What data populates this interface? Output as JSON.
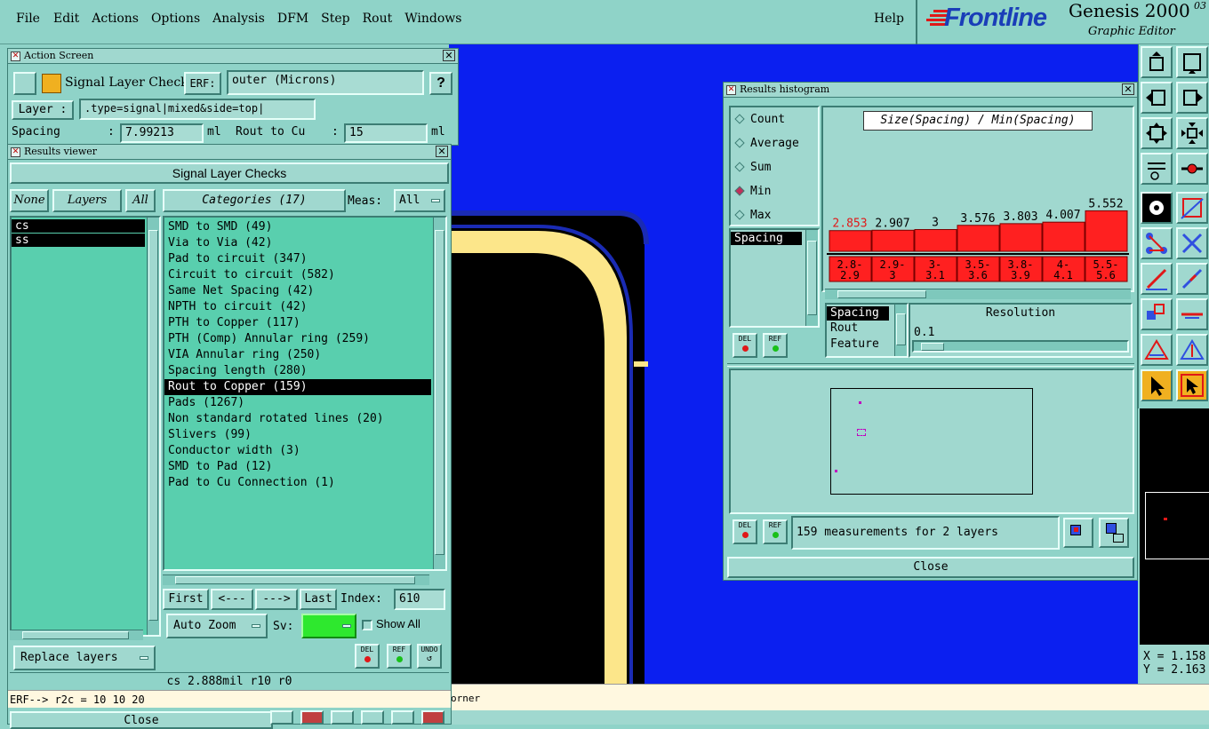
{
  "menubar": {
    "items": [
      "File",
      "Edit",
      "Actions",
      "Options",
      "Analysis",
      "DFM",
      "Step",
      "Rout",
      "Windows"
    ],
    "help": "Help",
    "brand": "Frontline",
    "product": "Genesis 2000",
    "version": "03",
    "subtitle": "Graphic Editor"
  },
  "action_screen": {
    "title": "Action Screen",
    "check_name": "Signal Layer Checks",
    "erf_label": "ERF:",
    "erf_value": "outer (Microns)",
    "help_label": "?",
    "layer_label": "Layer :",
    "layer_value": ".type=signal|mixed&side=top|",
    "spacing_label": "Spacing",
    "spacing_sep": ":",
    "spacing_value": "7.99213",
    "spacing_unit": "ml",
    "rout_label": "Rout to Cu",
    "rout_sep": ":",
    "rout_value": "15",
    "rout_unit": "ml"
  },
  "results_viewer": {
    "title": "Results viewer",
    "heading": "Signal Layer Checks",
    "none_label": "None",
    "layers_label": "Layers",
    "all_label": "All",
    "layers": [
      "cs",
      "ss"
    ],
    "categories_label": "Categories (17)",
    "meas_label": "Meas:",
    "meas_value": "All",
    "categories": [
      "SMD to SMD (49)",
      "Via to Via (42)",
      "Pad to circuit (347)",
      "Circuit to circuit (582)",
      "Same Net Spacing (42)",
      "NPTH to circuit (42)",
      "PTH to Copper (117)",
      "PTH (Comp) Annular ring (259)",
      "VIA Annular ring (250)",
      "Spacing length (280)",
      "Rout to Copper (159)",
      "Pads (1267)",
      "Non standard rotated lines (20)",
      "Slivers (99)",
      "Conductor width (3)",
      "SMD to Pad (12)",
      "Pad to Cu Connection (1)"
    ],
    "selected_category": 10,
    "first_label": "First",
    "prev_label": "<---",
    "next_label": "--->",
    "last_label": "Last",
    "index_label": "Index:",
    "index_value": "610",
    "autozoom_label": "Auto Zoom",
    "sv_label": "Sv:",
    "showall_label": "Show All",
    "replace_label": "Replace layers",
    "del_label": "DEL",
    "ref_label": "REF",
    "undo_label": "UNDO",
    "status": "cs 2.888mil  r10  r0",
    "erf_line": "ERF--> r2c = 10 10 20",
    "close_label": "Close"
  },
  "histogram": {
    "title": "Results histogram",
    "options": [
      "Count",
      "Average",
      "Sum",
      "Min",
      "Max"
    ],
    "selected_option": 3,
    "chart_title": "Size(Spacing) / Min(Spacing)",
    "field_list": [
      "Spacing"
    ],
    "axis_options": [
      "Spacing",
      "Rout",
      "Feature"
    ],
    "resolution_label": "Resolution",
    "resolution_value": "0.1",
    "del_label": "DEL",
    "ref_label": "REF",
    "measurement_text": "159 measurements for 2 layers",
    "close_label": "Close"
  },
  "chart_data": {
    "type": "bar",
    "title": "Size(Spacing) / Min(Spacing)",
    "categories": [
      "2.8-2.9",
      "2.9-3",
      "3-3.1",
      "3.5-3.6",
      "3.8-3.9",
      "4-4.1",
      "5.5-5.6"
    ],
    "category_lines": [
      [
        "2.8-",
        "2.9"
      ],
      [
        "2.9-",
        "3"
      ],
      [
        "3-",
        "3.1"
      ],
      [
        "3.5-",
        "3.6"
      ],
      [
        "3.8-",
        "3.9"
      ],
      [
        "4-",
        "4.1"
      ],
      [
        "5.5-",
        "5.6"
      ]
    ],
    "value_labels": [
      "2.853",
      "2.907",
      "3",
      "3.576",
      "3.803",
      "4.007",
      "5.552"
    ],
    "values": [
      2.853,
      2.907,
      3,
      3.576,
      3.803,
      4.007,
      5.552
    ],
    "ylim": [
      2.7,
      5.6
    ]
  },
  "coords": {
    "x_label": "X = 1.158",
    "y_label": "Y = 2.163"
  },
  "statusbar": {
    "text": "orner"
  },
  "colors": {
    "panel": "#a0d8cf",
    "list_bg": "#59cfae",
    "canvas_blue": "#0b1ff0",
    "trace_yellow": "#fce68a",
    "bar_red": "#ff2020",
    "accent_red": "#e01818"
  }
}
